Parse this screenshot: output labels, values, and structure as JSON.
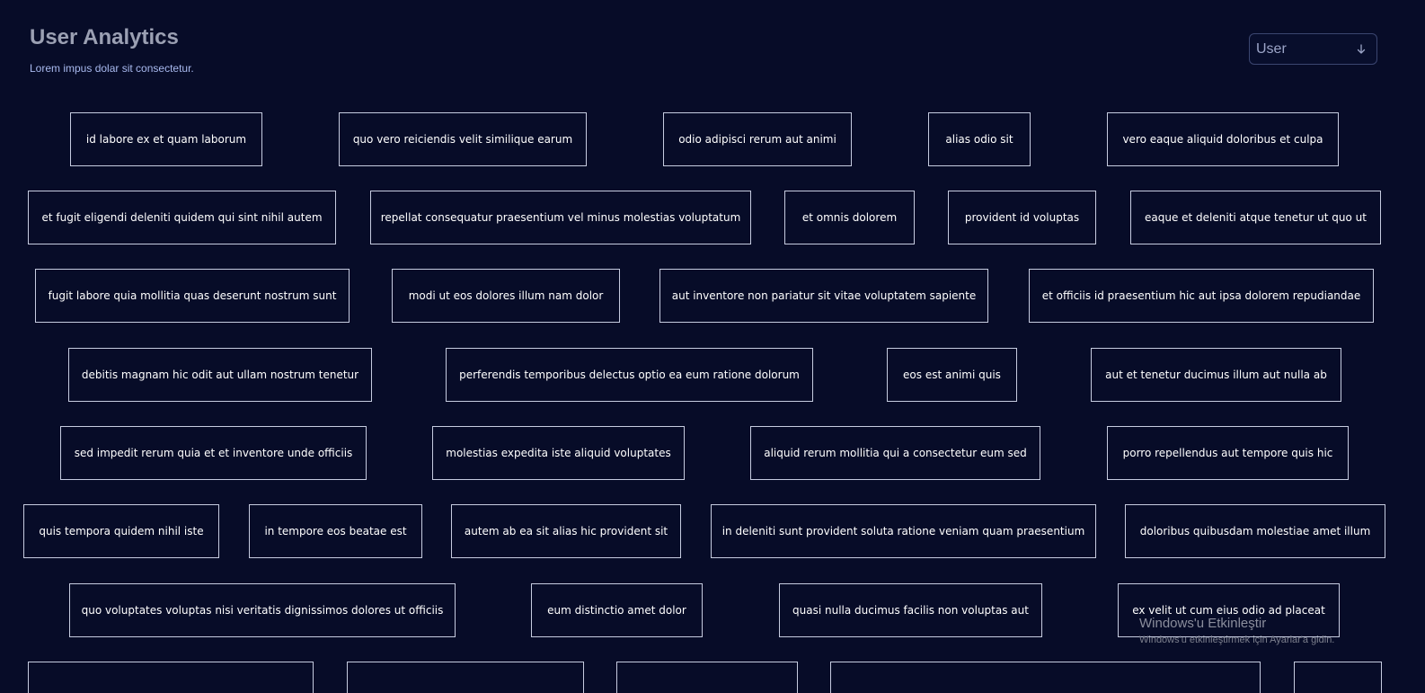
{
  "header": {
    "title": "User Analytics",
    "subtitle": "Lorem impus dolar sit consectetur."
  },
  "filter": {
    "selected": "User",
    "icon": "arrow-down-icon"
  },
  "tags": [
    "id labore ex et quam laborum",
    "quo vero reiciendis velit similique earum",
    "odio adipisci rerum aut animi",
    "alias odio sit",
    "vero eaque aliquid doloribus et culpa",
    "et fugit eligendi deleniti quidem qui sint nihil autem",
    "repellat consequatur praesentium vel minus molestias voluptatum",
    "et omnis dolorem",
    "provident id voluptas",
    "eaque et deleniti atque tenetur ut quo ut",
    "fugit labore quia mollitia quas deserunt nostrum sunt",
    "modi ut eos dolores illum nam dolor",
    "aut inventore non pariatur sit vitae voluptatem sapiente",
    "et officiis id praesentium hic aut ipsa dolorem repudiandae",
    "debitis magnam hic odit aut ullam nostrum tenetur",
    "perferendis temporibus delectus optio ea eum ratione dolorum",
    "eos est animi quis",
    "aut et tenetur ducimus illum aut nulla ab",
    "sed impedit rerum quia et et inventore unde officiis",
    "molestias expedita iste aliquid voluptates",
    "aliquid rerum mollitia qui a consectetur eum sed",
    "porro repellendus aut tempore quis hic",
    "quis tempora quidem nihil iste",
    "in tempore eos beatae est",
    "autem ab ea sit alias hic provident sit",
    "in deleniti sunt provident soluta ratione veniam quam praesentium",
    "doloribus quibusdam molestiae amet illum",
    "quo voluptates voluptas nisi veritatis dignissimos dolores ut officiis",
    "eum distinctio amet dolor",
    "quasi nulla ducimus facilis non voluptas aut",
    "ex velit ut cum eius odio ad placeat"
  ],
  "watermark": {
    "title": "Windows'u Etkinleştir",
    "text": "Windows'u etkinleştirmek için Ayarlar'a gidin."
  },
  "colors": {
    "background": "#070c28",
    "tag_border": "#c6cce0",
    "title": "#9ba0b3",
    "subtitle": "#a8b9ee"
  }
}
